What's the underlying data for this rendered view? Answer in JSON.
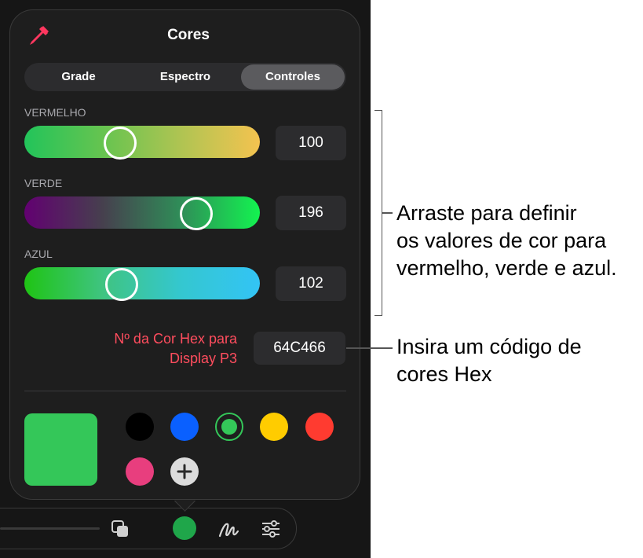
{
  "title": "Cores",
  "tabs": [
    {
      "label": "Grade"
    },
    {
      "label": "Espectro"
    },
    {
      "label": "Controles",
      "selected": true
    }
  ],
  "sliders": [
    {
      "label": "VERMELHO",
      "value": "100",
      "level": 100
    },
    {
      "label": "VERDE",
      "value": "196",
      "level": 196
    },
    {
      "label": "AZUL",
      "value": "102",
      "level": 102
    }
  ],
  "hex": {
    "label_line1": "Nº da Cor Hex para",
    "label_line2": "Display P3",
    "value": "64C466"
  },
  "current_color": "#34C759",
  "swatches": [
    {
      "name": "black",
      "color": "#000000"
    },
    {
      "name": "blue",
      "color": "#0A60FF"
    },
    {
      "name": "green",
      "color": "#34C759",
      "selected": true
    },
    {
      "name": "yellow",
      "color": "#FFCC00"
    },
    {
      "name": "red",
      "color": "#FF3B30"
    },
    {
      "name": "pink",
      "color": "#E83E7E"
    }
  ],
  "icons": {
    "eyedropper": "eyedropper-icon",
    "add": "plus-icon",
    "toolbar": [
      "layers-icon",
      "color-dot-icon",
      "pen-stroke-icon",
      "sliders-icon"
    ]
  },
  "callouts": {
    "sliders_line1": "Arraste para definir",
    "sliders_line2": "os valores de cor para",
    "sliders_line3": "vermelho, verde e azul.",
    "hex_line1": "Insira um código de",
    "hex_line2": "cores Hex"
  }
}
